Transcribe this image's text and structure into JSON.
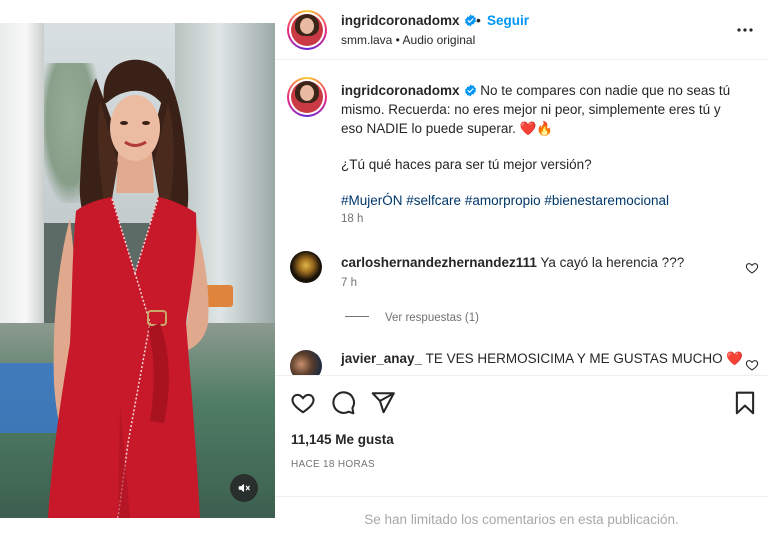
{
  "post": {
    "username": "ingridcoronadomx",
    "follow_label": "Seguir",
    "audio": "smm.lava • Audio original",
    "dot": "•"
  },
  "caption": {
    "username": "ingridcoronadomx",
    "line1": "No te compares con nadie que no seas tú mismo. Recuerda: no eres mejor ni peor, simplemente eres tú y eso NADIE lo puede superar. ❤️🔥",
    "line2": "¿Tú qué haces para ser tú mejor versión?",
    "hashtags": [
      "#MujerÓN",
      "#selfcare",
      "#amorpropio",
      "#bienestaremocional"
    ],
    "time": "18 h"
  },
  "comments": [
    {
      "username": "carloshernandezhernandez111",
      "text": "Ya cayó la herencia ???",
      "time": "7 h",
      "replies_label": "Ver respuestas (1)"
    },
    {
      "username": "javier_anay_",
      "text": "TE VES HERMOSICIMA Y ME GUSTAS MUCHO ❤️"
    }
  ],
  "actions": {
    "likes": "11,145 Me gusta",
    "posted": "HACE 18 HORAS"
  },
  "footer": {
    "limited": "Se han limitado los comentarios en esta publicación."
  },
  "icons": {
    "verified": "verified-badge-icon",
    "more": "more-options-icon",
    "like": "heart-icon",
    "comment": "comment-icon",
    "share": "share-icon",
    "save": "bookmark-icon",
    "mute": "muted-speaker-icon"
  },
  "colors": {
    "accent": "#0095f6",
    "hashtag": "#00376b",
    "muted_text": "#737373",
    "dress": "#c8192b"
  }
}
